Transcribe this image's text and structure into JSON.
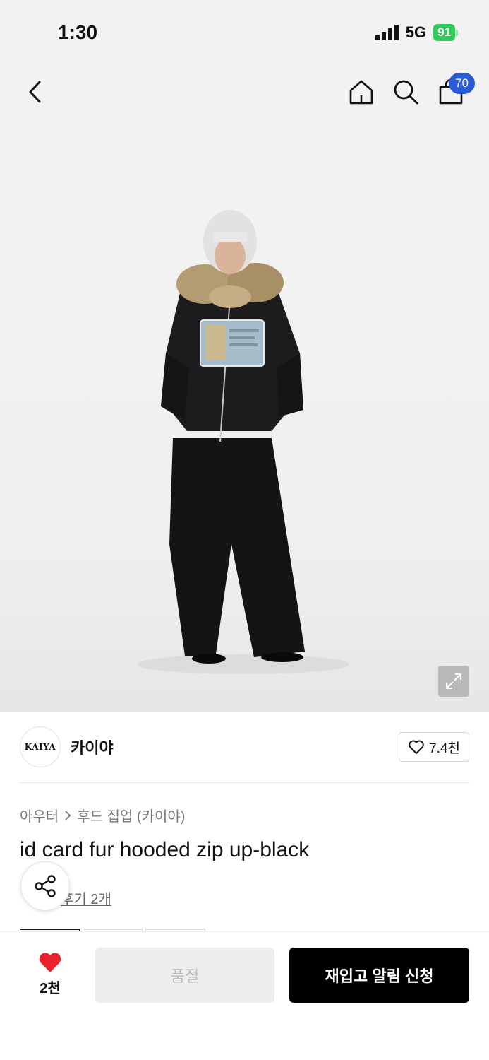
{
  "status_bar": {
    "time": "1:30",
    "network": "5G",
    "battery": "91"
  },
  "nav": {
    "cart_count": "70"
  },
  "icons": {
    "back": "chevron-left-icon",
    "home": "home-icon",
    "search": "search-icon",
    "cart": "shopping-bag-icon",
    "expand": "expand-icon",
    "heart_outline": "heart-outline-icon",
    "heart_filled": "heart-filled-icon",
    "share": "share-icon"
  },
  "brand": {
    "logo_text": "KAIYA",
    "name": "카이야",
    "likes": "7.4천"
  },
  "breadcrumb": {
    "category": "아우터",
    "subcategory": "후드 집업 (카이야)"
  },
  "product": {
    "title": "id card fur hooded zip up-black",
    "reviews": "후기 2개"
  },
  "bottom_bar": {
    "wish_count": "2천",
    "soldout_label": "품절",
    "restock_label": "재입고 알림 신청"
  },
  "colors": {
    "accent": "#2a5bd7",
    "heart": "#e8232b",
    "battery": "#34c759"
  }
}
